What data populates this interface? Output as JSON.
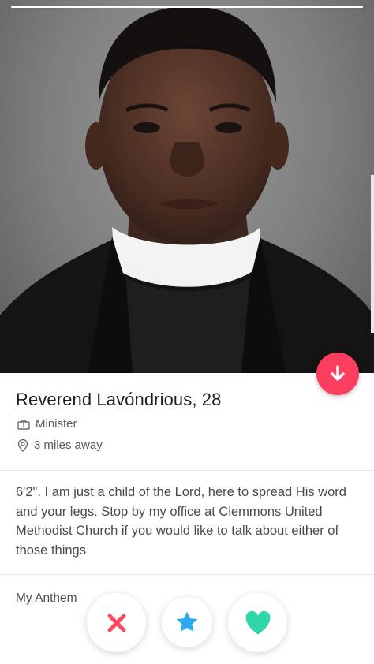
{
  "profile": {
    "name_age": "Reverend Lavóndrious, 28",
    "job": "Minister",
    "distance": "3 miles away",
    "bio": "6'2\". I am just a child of the Lord, here to spread His word and your legs. Stop by my office at Clemmons United Methodist Church if you would like to talk about either of those things",
    "anthem_title": "My Anthem"
  },
  "photo": {
    "photo_count": 1,
    "current_photo": 1
  },
  "icons": {
    "info": "arrow-down-icon",
    "job": "briefcase-icon",
    "distance": "location-pin-icon",
    "nope": "close-icon",
    "super_like": "star-icon",
    "like": "heart-icon"
  },
  "colors": {
    "info_button": "#fd3e5e",
    "nope": "#fd4a5c",
    "super_like": "#2aa8f2",
    "like": "#2fd6a8"
  }
}
